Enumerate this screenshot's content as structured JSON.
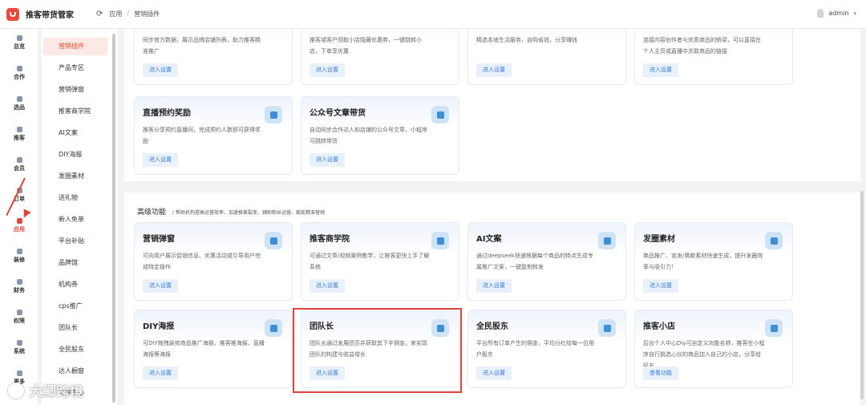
{
  "header": {
    "app_title": "推客带货管家",
    "refresh_icon": "refresh-icon",
    "breadcrumb": [
      "应用",
      "营销插件"
    ],
    "user": "admin"
  },
  "rail": {
    "active": "应用",
    "items": [
      "总览",
      "合作",
      "选品",
      "推客",
      "会员",
      "订单",
      "应用",
      "装修",
      "财务",
      "权限",
      "系统",
      "更多"
    ]
  },
  "submenu": {
    "active": "营销插件",
    "items": [
      "营销插件",
      "产品专区",
      "营销弹窗",
      "推客商学院",
      "AI文案",
      "DIY海报",
      "发圈素材",
      "送礼物",
      "新人免单",
      "平台补贴",
      "品牌馆",
      "机构券",
      "cps推广",
      "团队长",
      "全民股东",
      "达人橱窗",
      "分享中心"
    ]
  },
  "top_cards": [
    {
      "title": "",
      "desc": "同步官方数据，展示品牌店铺列表，助力推客精准推广",
      "button": "进入设置"
    },
    {
      "title": "",
      "desc": "推客或客户领取小店隐藏优惠券，一键跳转小店，下单享优惠",
      "button": "进入设置"
    },
    {
      "title": "",
      "desc": "精选本地生活服务，自购省钱，分享赚钱",
      "button": "进入设置"
    },
    {
      "title": "",
      "desc": "连接内容创作者与优质商品的轿梁，可以直接在个人主页或直播中关联商品的链接",
      "button": "进入设置"
    },
    {
      "title": "直播预约奖励",
      "desc": "推客分享预约直播间，完成预约人数即可获得奖励",
      "button": "进入设置",
      "icon": "play-icon"
    },
    {
      "title": "公众号文章带货",
      "desc": "自动同步合作达人和店铺的公众号文章，小程序可跳转带货",
      "button": "进入设置",
      "icon": "article-icon"
    }
  ],
  "advanced": {
    "title": "高级功能",
    "subtitle": "/ 帮助机构提高运营效率、加速推客裂变、辅助粉丝运营、赋能精准营销",
    "cards": [
      {
        "title": "营销弹窗",
        "desc": "可向用户展示促销信息、优惠活动或引导用户完成特定操作",
        "button": "进入设置",
        "icon": "popup-icon"
      },
      {
        "title": "推客商学院",
        "desc": "可通过文章/视频案例教学，让推客更快上手了解系统",
        "button": "进入设置",
        "icon": "graduation-cap-icon"
      },
      {
        "title": "AI文案",
        "desc": "通过deepseek快速根据每个商品的特点生成专属推广文案，一键复制转发",
        "button": "进入设置",
        "icon": "ai-bird-icon"
      },
      {
        "title": "发圈素材",
        "desc": "商品推广、宣发/猜款素材快速生成，提升发圈效率与吸引力！",
        "button": "进入设置",
        "icon": "material-icon"
      },
      {
        "title": "DIY海报",
        "desc": "可DIY拖拽装修商品推广海报、推客推海报、直播海报等海报",
        "button": "进入设置",
        "icon": "poster-icon"
      },
      {
        "title": "团队长",
        "desc": "团队长通过发展团员并获取其下半佣金，来实现团队的构建与收益增长",
        "button": "进入设置",
        "icon": "crown-icon"
      },
      {
        "title": "全民股东",
        "desc": "平台所有订单产生的佣金，平均分红给每一位用户股东",
        "button": "进入设置",
        "icon": "user-icon"
      },
      {
        "title": "推客小店",
        "desc": "后台个人中心Diy可自定义功能名称，推客在小程序自行挑选心仪的商品加入自己的小店，分享给好友",
        "button": "查看功能",
        "icon": "medal-icon"
      }
    ]
  },
  "watermark": "大鲫跨境",
  "colors": {
    "accent": "#e2473b",
    "link": "#3a7bd5",
    "highlight": "#e0433e"
  }
}
